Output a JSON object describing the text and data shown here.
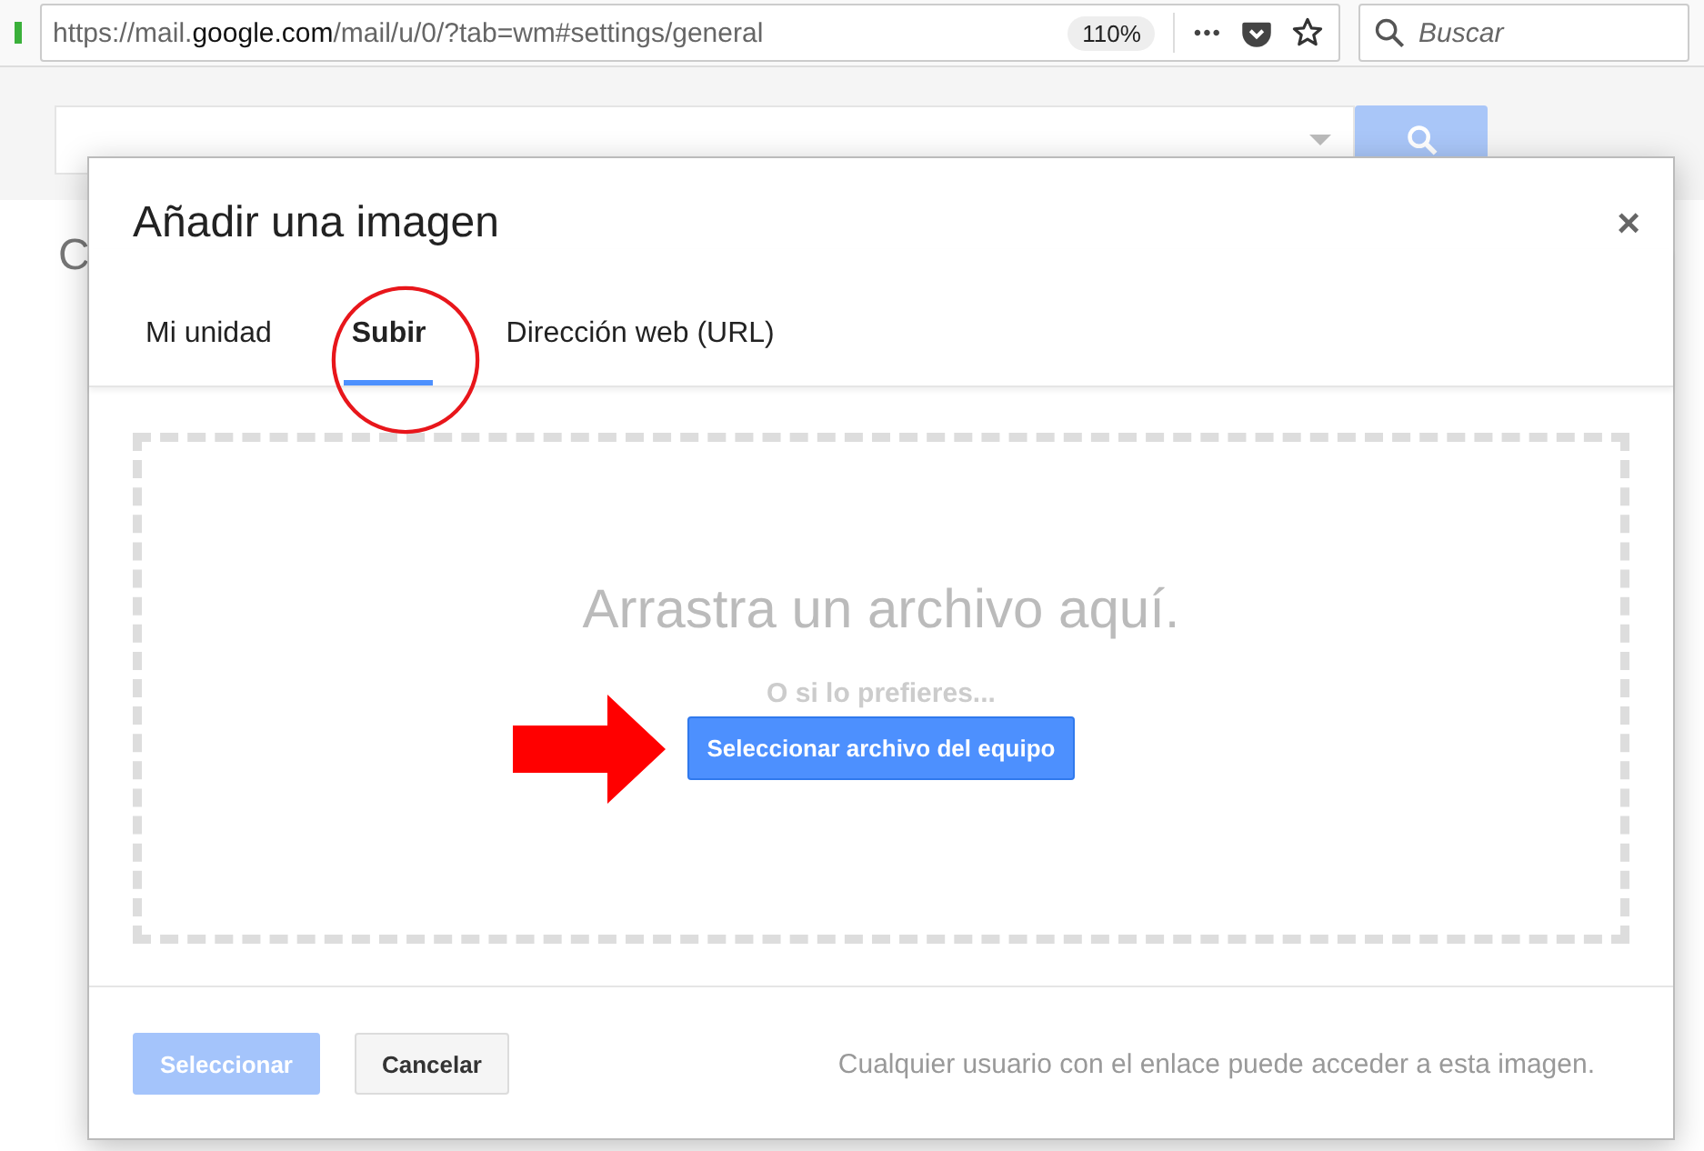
{
  "browser": {
    "url": "https://mail.**google.com**/mail/u/0/?tab=wm#settings/general",
    "zoom": "110%",
    "more": "•••",
    "search_placeholder": "Buscar"
  },
  "background": {
    "heading_fragment": "C"
  },
  "dialog": {
    "title": "Añadir una imagen",
    "close": "×",
    "tabs": [
      {
        "label": "Mi unidad",
        "selected": false
      },
      {
        "label": "Subir",
        "selected": true
      },
      {
        "label": "Dirección web (URL)",
        "selected": false
      }
    ],
    "drop_text": "Arrastra un archivo aquí.",
    "or_text": "O si lo prefieres...",
    "choose_button": "Seleccionar archivo del equipo",
    "buttons": [
      {
        "label": "Seleccionar",
        "kind": "primary",
        "disabled": true
      },
      {
        "label": "Cancelar",
        "kind": "secondary",
        "disabled": false
      }
    ],
    "note": "Cualquier usuario con el enlace puede acceder a esta imagen."
  }
}
